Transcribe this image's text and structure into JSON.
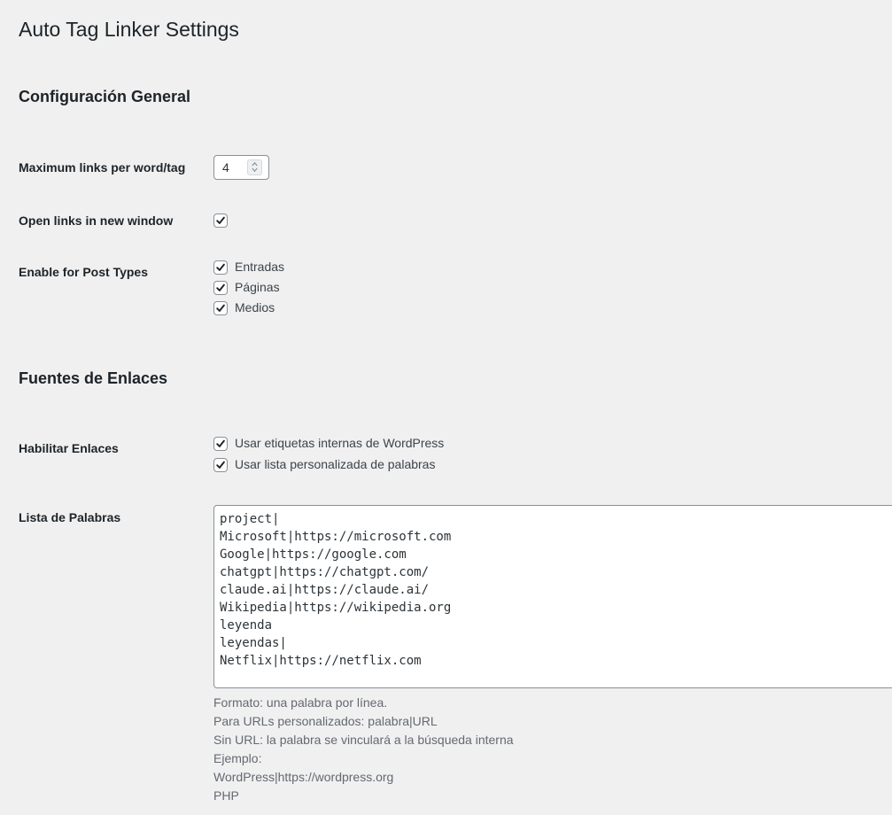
{
  "page": {
    "title": "Auto Tag Linker Settings"
  },
  "general": {
    "heading": "Configuración General",
    "max_links": {
      "label": "Maximum links per word/tag",
      "value": "4"
    },
    "new_window": {
      "label": "Open links in new window",
      "checked": true
    },
    "post_types": {
      "label": "Enable for Post Types",
      "options": [
        {
          "label": "Entradas",
          "checked": true
        },
        {
          "label": "Páginas",
          "checked": true
        },
        {
          "label": "Medios",
          "checked": true
        }
      ]
    }
  },
  "sources": {
    "heading": "Fuentes de Enlaces",
    "enable": {
      "label": "Habilitar Enlaces",
      "options": [
        {
          "label": "Usar etiquetas internas de WordPress",
          "checked": true
        },
        {
          "label": "Usar lista personalizada de palabras",
          "checked": true
        }
      ]
    },
    "word_list": {
      "label": "Lista de Palabras",
      "lines": [
        "project|",
        "Microsoft|https://microsoft.com",
        "Google|https://google.com",
        "chatgpt|https://chatgpt.com/",
        "claude.ai|https://claude.ai/",
        "Wikipedia|https://wikipedia.org",
        "leyenda",
        "leyendas|",
        "Netflix|https://netflix.com"
      ],
      "help": [
        "Formato: una palabra por línea.",
        "Para URLs personalizados: palabra|URL",
        "Sin URL: la palabra se vinculará a la búsqueda interna",
        "Ejemplo:",
        "WordPress|https://wordpress.org",
        "PHP"
      ]
    }
  },
  "icons": {
    "checkmark": "checkmark-icon",
    "spinner_up": "chevron-up-icon",
    "spinner_down": "chevron-down-icon"
  },
  "colors": {
    "background": "#f0f0f1",
    "text": "#1d2327",
    "help_text": "#646970",
    "border": "#8c8f94",
    "check": "#1d2327"
  }
}
